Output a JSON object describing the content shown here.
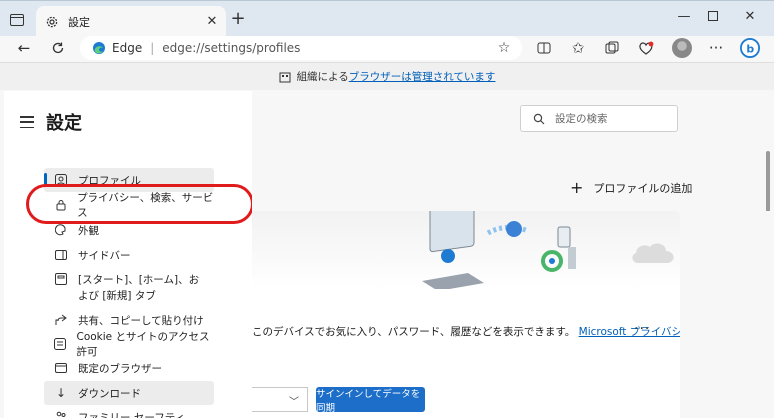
{
  "tab": {
    "title": "設定"
  },
  "address": {
    "label": "Edge",
    "separator": "|",
    "url": "edge://settings/profiles"
  },
  "banner": {
    "prefix": "組織による",
    "link": "ブラウザーは管理されています"
  },
  "sidebar": {
    "title": "設定",
    "items": [
      {
        "label": "プロファイル",
        "icon": "profile-icon"
      },
      {
        "label": "プライバシー、検索、サービス",
        "icon": "lock-icon"
      },
      {
        "label": "外観",
        "icon": "appearance-icon"
      },
      {
        "label": "サイドバー",
        "icon": "sidebar-icon"
      },
      {
        "label": "[スタート]、[ホーム]、および [新規] タブ",
        "icon": "start-home-icon"
      },
      {
        "label": "共有、コピーして貼り付け",
        "icon": "share-icon"
      },
      {
        "label": "Cookie とサイトのアクセス許可",
        "icon": "cookie-icon"
      },
      {
        "label": "既定のブラウザー",
        "icon": "default-browser-icon"
      },
      {
        "label": "ダウンロード",
        "icon": "download-icon"
      },
      {
        "label": "ファミリー セーフティ",
        "icon": "family-icon"
      }
    ]
  },
  "search": {
    "placeholder": "設定の検索"
  },
  "main": {
    "add_profile": "プロファイルの追加",
    "description": "このデバイスでお気に入り、パスワード、履歴などを表示できます。",
    "privacy_link": "Microsoft プライバシ",
    "sync_button": "サインインしてデータを同期"
  },
  "colors": {
    "accent": "#0067c0",
    "sync_button": "#1c6ec8",
    "highlight": "#e01b1b"
  }
}
